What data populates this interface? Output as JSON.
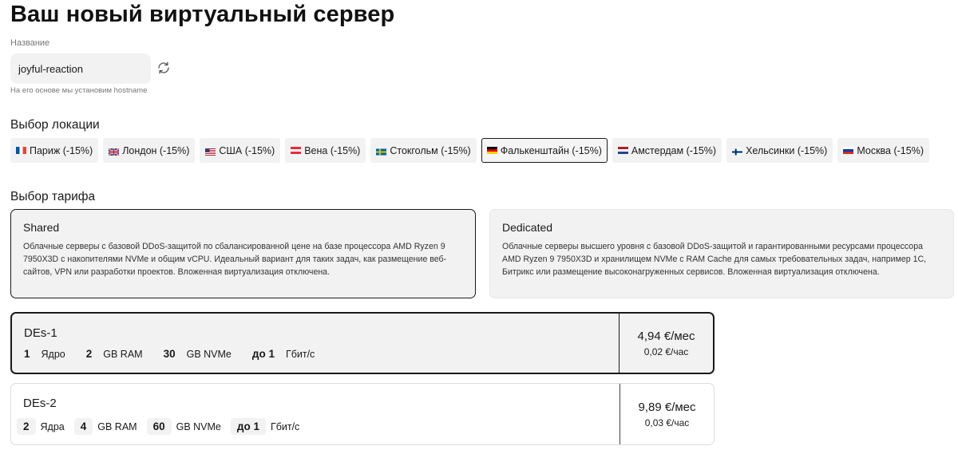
{
  "page": {
    "title": "Ваш новый виртуальный сервер"
  },
  "name_field": {
    "label": "Название",
    "value": "joyful-reaction",
    "hint": "На его основе мы установим hostname"
  },
  "locations": {
    "title": "Выбор локации",
    "items": [
      {
        "label": "Париж (-15%)",
        "flag": "fr"
      },
      {
        "label": "Лондон (-15%)",
        "flag": "gb"
      },
      {
        "label": "США (-15%)",
        "flag": "us"
      },
      {
        "label": "Вена (-15%)",
        "flag": "at"
      },
      {
        "label": "Стокгольм (-15%)",
        "flag": "se"
      },
      {
        "label": "Фалькенштайн (-15%)",
        "flag": "de"
      },
      {
        "label": "Амстердам (-15%)",
        "flag": "nl"
      },
      {
        "label": "Хельсинки (-15%)",
        "flag": "fi"
      },
      {
        "label": "Москва (-15%)",
        "flag": "ru"
      }
    ],
    "selected": "Фалькенштайн (-15%)"
  },
  "tariffs": {
    "title": "Выбор тарифа",
    "plans": [
      {
        "name": "Shared",
        "description": "Облачные серверы с базовой DDoS-защитой по сбалансированной цене на базе процессора AMD Ryzen 9 7950X3D с накопителями NVMe и общим vCPU. Идеальный вариант для таких задач, как размещение веб-сайтов, VPN или разработки проектов. Вложенная виртуализация отключена."
      },
      {
        "name": "Dedicated",
        "description": "Облачные серверы высшего уровня с базовой DDoS-защитой и гарантированными ресурсами процессора AMD Ryzen 9 7950X3D и хранилищем NVMe с RAM Cache для самых требовательных задач, например 1С, Битрикс или размещение высоконагруженных сервисов. Вложенная виртуализация отключена."
      }
    ],
    "selected": "Shared"
  },
  "tiers": [
    {
      "name": "DEs-1",
      "cpu_num": "1",
      "cpu_label": "Ядро",
      "ram_num": "2",
      "ram_label": "GB RAM",
      "disk_num": "30",
      "disk_label": "GB NVMe",
      "net_num": "до 1",
      "net_label": "Гбит/с",
      "price_month": "4,94 €/мес",
      "price_hour": "0,02 €/час"
    },
    {
      "name": "DEs-2",
      "cpu_num": "2",
      "cpu_label": "Ядра",
      "ram_num": "4",
      "ram_label": "GB RAM",
      "disk_num": "60",
      "disk_label": "GB NVMe",
      "net_num": "до 1",
      "net_label": "Гбит/с",
      "price_month": "9,89 €/мес",
      "price_hour": "0,03 €/час"
    }
  ],
  "colors": {
    "accent": "#1a1a1a",
    "card_bg": "#f2f2f2",
    "muted_text": "#777777"
  }
}
